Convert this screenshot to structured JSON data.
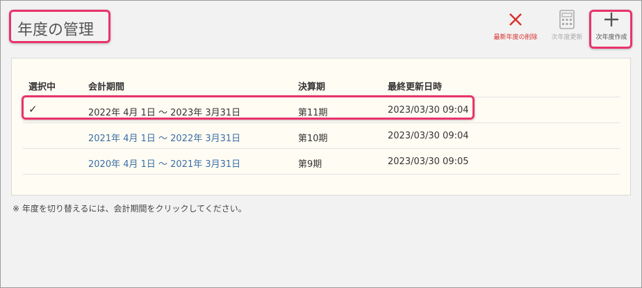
{
  "header": {
    "title": "年度の管理"
  },
  "toolbar": {
    "delete_label": "最新年度の削除",
    "update_label": "次年度更新",
    "create_label": "次年度作成",
    "delete_color": "#d9302f"
  },
  "table": {
    "columns": [
      "選択中",
      "会計期間",
      "決算期",
      "最終更新日時"
    ],
    "rows": [
      {
        "selected": "✓",
        "period": "2022年 4月 1日 〜 2023年 3月31日",
        "term": "第11期",
        "updated": "2023/03/30 09:04"
      },
      {
        "selected": "",
        "period": "2021年 4月 1日 〜 2022年 3月31日",
        "term": "第10期",
        "updated": "2023/03/30 09:04"
      },
      {
        "selected": "",
        "period": "2020年 4月 1日 〜 2021年 3月31日",
        "term": "第9期",
        "updated": "2023/03/30 09:05"
      }
    ]
  },
  "note": "※ 年度を切り替えるには、会計期間をクリックしてください。"
}
